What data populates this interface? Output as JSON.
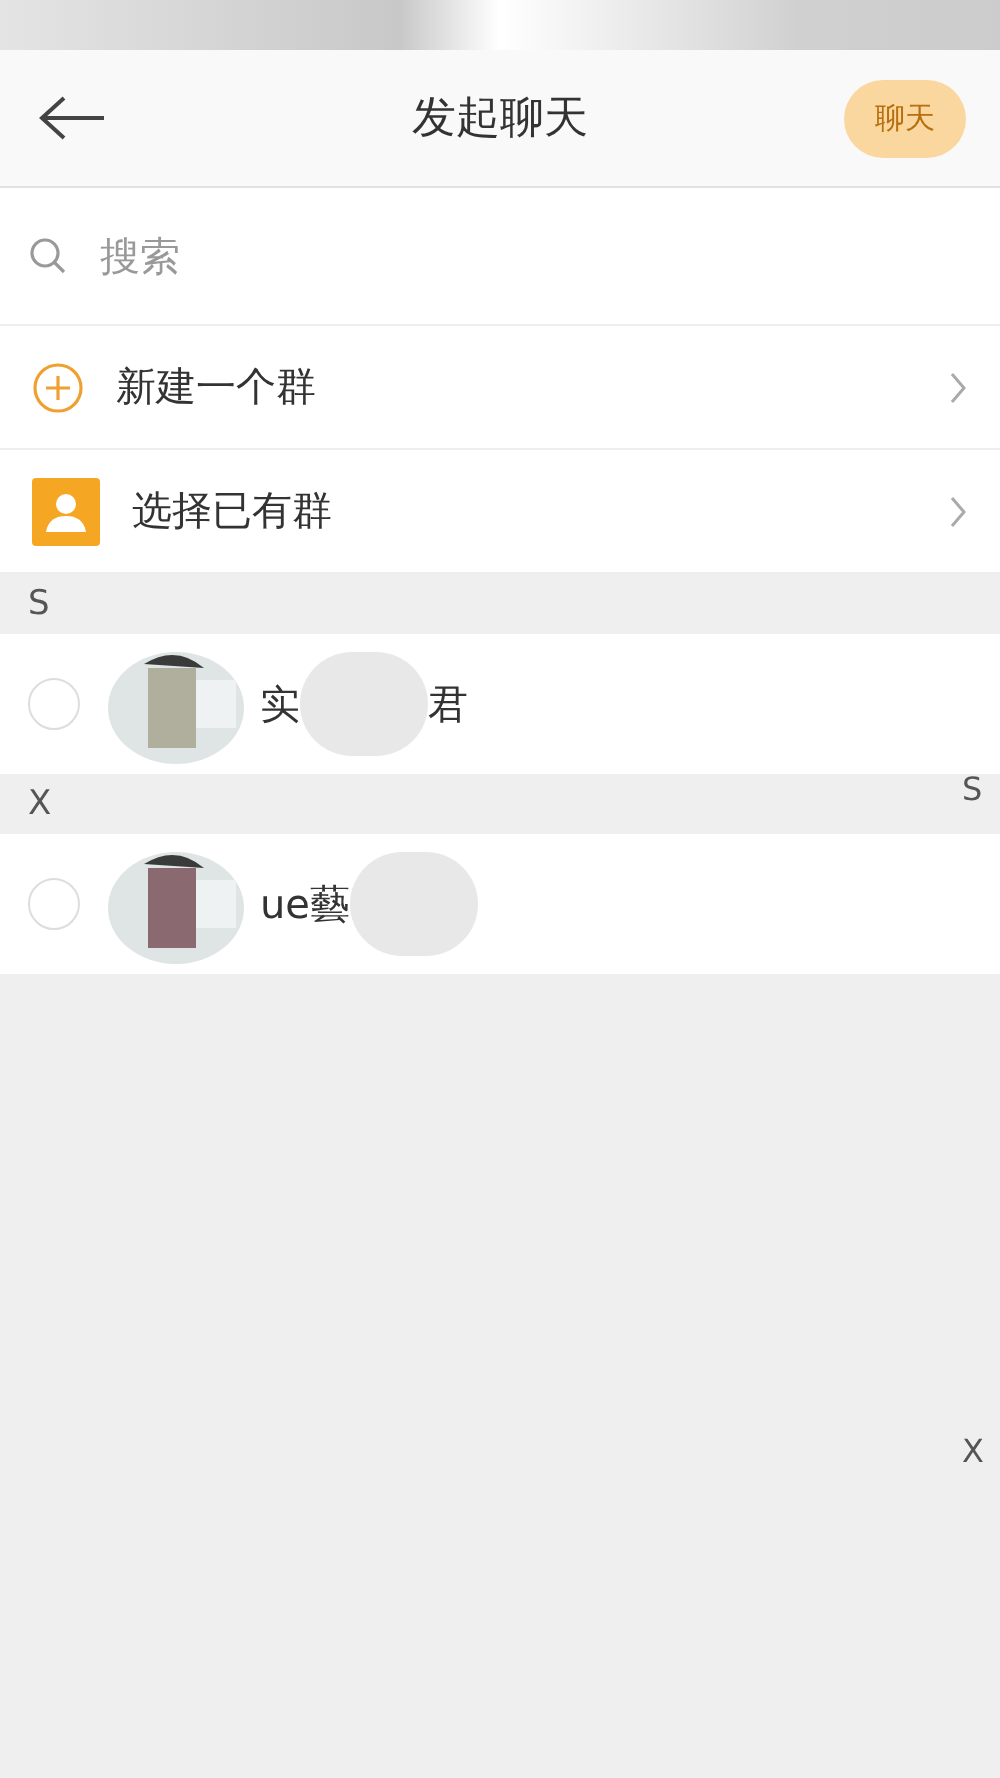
{
  "header": {
    "title": "发起聊天",
    "action": {
      "label": "聊天",
      "disabled": true
    }
  },
  "search": {
    "placeholder": "搜索"
  },
  "actions": [
    {
      "kind": "new-group",
      "label": "新建一个群"
    },
    {
      "kind": "existing-group",
      "label": "选择已有群"
    }
  ],
  "sections": [
    {
      "letter": "S",
      "contacts": [
        {
          "name": "实",
          "name_tail": "君",
          "selected": false
        }
      ]
    },
    {
      "letter": "X",
      "contacts": [
        {
          "name": "ue藝",
          "selected": false
        }
      ]
    }
  ],
  "index_bar": [
    "S",
    "X"
  ]
}
